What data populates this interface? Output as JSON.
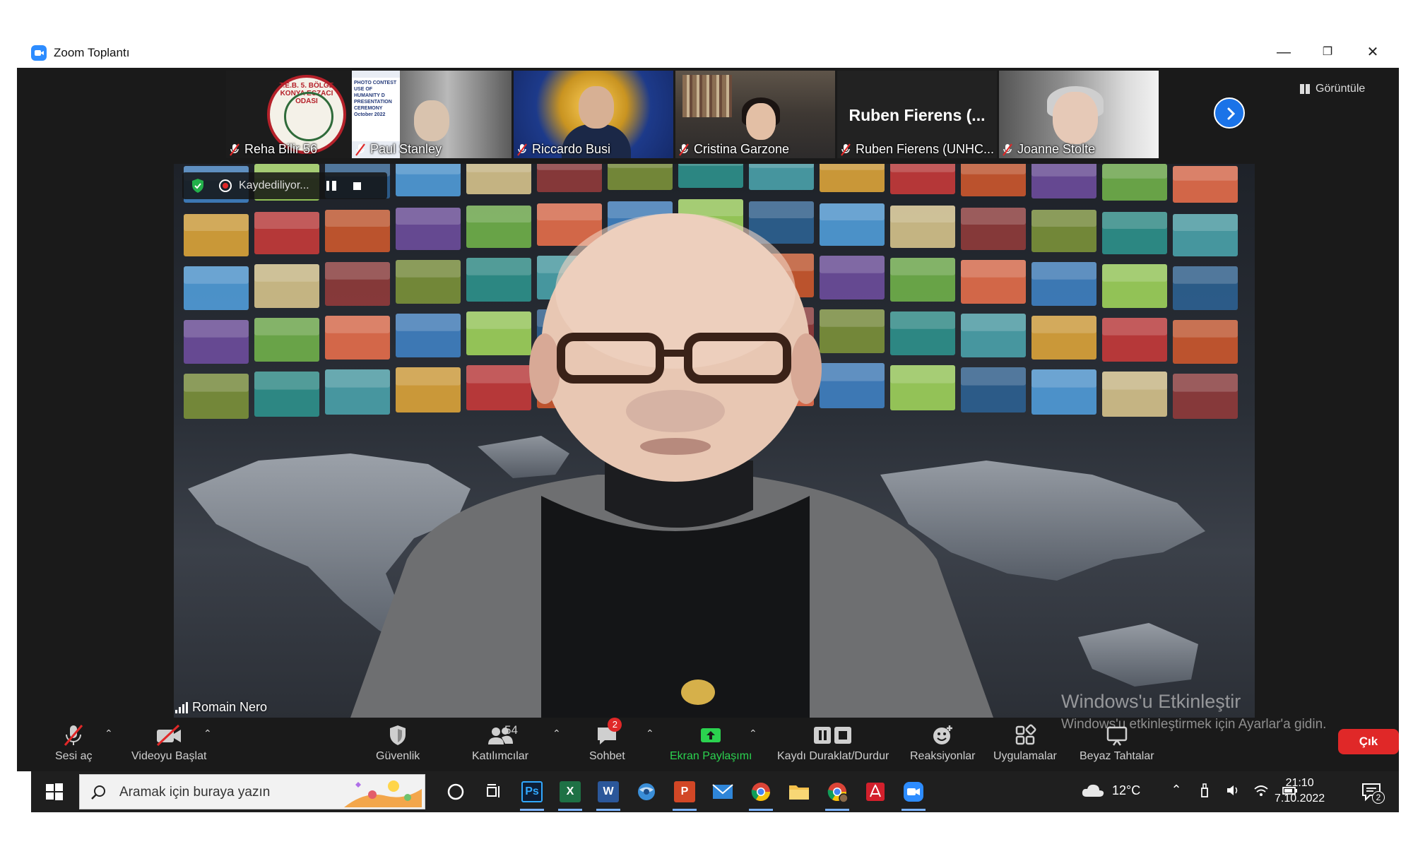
{
  "window": {
    "title": "Zoom Toplantı",
    "controls": {
      "minimize": "—",
      "restore": "❐",
      "close": "✕"
    }
  },
  "gallery": {
    "participants": [
      {
        "name": "Reha Bilir 56",
        "muted": true
      },
      {
        "name": "Paul Stanley",
        "muted": true
      },
      {
        "name": "Riccardo Busi",
        "muted": true
      },
      {
        "name": "Cristina Garzone",
        "muted": true
      },
      {
        "name": "Ruben Fierens (UNHC...",
        "display_name": "Ruben Fierens (...",
        "muted": true
      },
      {
        "name": "Joanne Stolte",
        "muted": true
      }
    ],
    "view_button": "Görüntüle",
    "logo_text": "T.E.B. 5. BÖLGE KONYA ECZACI ODASI",
    "poster_text": "PHOTO CONTEST USE OF HUMANITY D PRESENTATION CEREMONY October 2022"
  },
  "recording": {
    "label": "Kaydediliyor..."
  },
  "speaker": {
    "name": "Romain Nero"
  },
  "toolbar": {
    "buttons": [
      {
        "id": "unmute",
        "label": "Sesi aç",
        "icon": "mic-off-icon"
      },
      {
        "id": "video",
        "label": "Videoyu Başlat",
        "icon": "video-off-icon"
      },
      {
        "id": "security",
        "label": "Güvenlik",
        "icon": "shield-icon"
      },
      {
        "id": "participants",
        "label": "Katılımcılar",
        "icon": "participants-icon",
        "count": "54"
      },
      {
        "id": "chat",
        "label": "Sohbet",
        "icon": "chat-icon",
        "badge": "2"
      },
      {
        "id": "share",
        "label": "Ekran Paylaşımı",
        "icon": "share-screen-icon"
      },
      {
        "id": "record",
        "label": "Kaydı Duraklat/Durdur",
        "icon": "pause-stop-icon"
      },
      {
        "id": "reactions",
        "label": "Reaksiyonlar",
        "icon": "smiley-icon"
      },
      {
        "id": "apps",
        "label": "Uygulamalar",
        "icon": "apps-icon"
      },
      {
        "id": "whiteboard",
        "label": "Beyaz Tahtalar",
        "icon": "whiteboard-icon"
      }
    ],
    "leave": "Çık",
    "share_color": "#2bd24f",
    "leave_color": "#e02828"
  },
  "watermark": {
    "title": "Windows'u Etkinleştir",
    "subtitle": "Windows'u etkinleştirmek için Ayarlar'a gidin."
  },
  "taskbar": {
    "search_placeholder": "Aramak için buraya yazın",
    "apps": [
      "cortana-icon",
      "task-view-icon",
      "photoshop-icon",
      "excel-icon",
      "word-icon",
      "browser-icon",
      "powerpoint-icon",
      "mail-icon",
      "chrome-icon",
      "file-explorer-icon",
      "chrome-profile-icon",
      "acrobat-icon",
      "zoom-icon"
    ],
    "app_labels": {
      "photoshop": "Ps",
      "excel": "X",
      "word": "W",
      "powerpoint": "P"
    },
    "weather": "12°C",
    "time": "21:10",
    "date": "7.10.2022",
    "notifications": "2"
  }
}
